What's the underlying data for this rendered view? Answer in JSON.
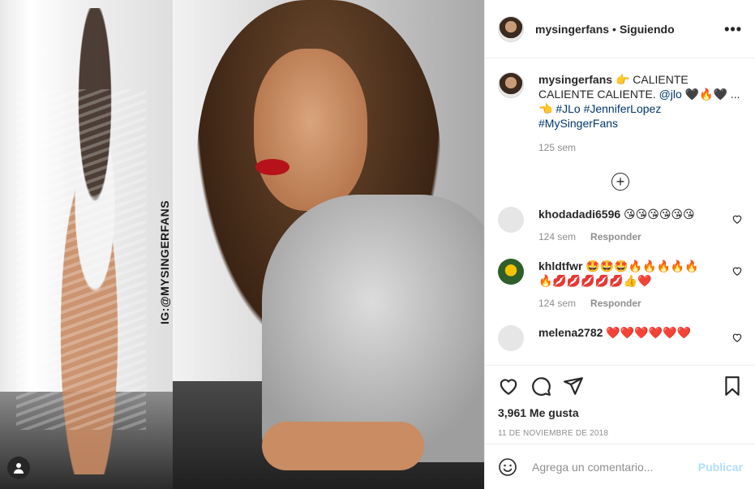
{
  "media": {
    "watermark": "IG:@MYSINGERFANS",
    "user_badge_icon": "user-icon"
  },
  "header": {
    "username": "mysingerfans",
    "separator": "•",
    "follow_status": "Siguiendo",
    "more_icon": "ellipsis-icon",
    "more_label": "•••"
  },
  "caption": {
    "username": "mysingerfans",
    "text": "👉 CALIENTE CALIENTE CALIENTE.",
    "mention": "@jlo",
    "emojis": "🖤🔥🖤 ... 👈",
    "hashtag1": "#JLo",
    "hashtag2": "#JenniferLopez",
    "hashtag3": "#MySingerFans",
    "time": "125 sem"
  },
  "load_more": {
    "icon": "plus-circle-icon",
    "label": "+"
  },
  "comments": [
    {
      "username": "khodadadi6596",
      "text": "😘😘😘😘😘😘",
      "time": "124 sem",
      "reply": "Responder"
    },
    {
      "username": "khldtfwr",
      "text": "🤩🤩🤩🔥🔥🔥🔥🔥🔥💋💋💋💋💋👍❤️",
      "time": "124 sem",
      "reply": "Responder"
    },
    {
      "username": "melena2782",
      "text": "❤️❤️❤️❤️❤️❤️",
      "time": "",
      "reply": ""
    }
  ],
  "actions": {
    "like_icon": "heart-icon",
    "comment_icon": "comment-icon",
    "share_icon": "paper-plane-icon",
    "save_icon": "bookmark-icon",
    "likes": "3,961 Me gusta",
    "date": "11 DE NOVIEMBRE DE 2018"
  },
  "add_comment": {
    "placeholder": "Agrega un comentario...",
    "post_label": "Publicar",
    "emoji_icon": "smiley-icon"
  },
  "colors": {
    "link": "#00376b",
    "muted": "#8e8e8e",
    "post_disabled": "#b2dffc",
    "heart_red": "#e0245e"
  }
}
